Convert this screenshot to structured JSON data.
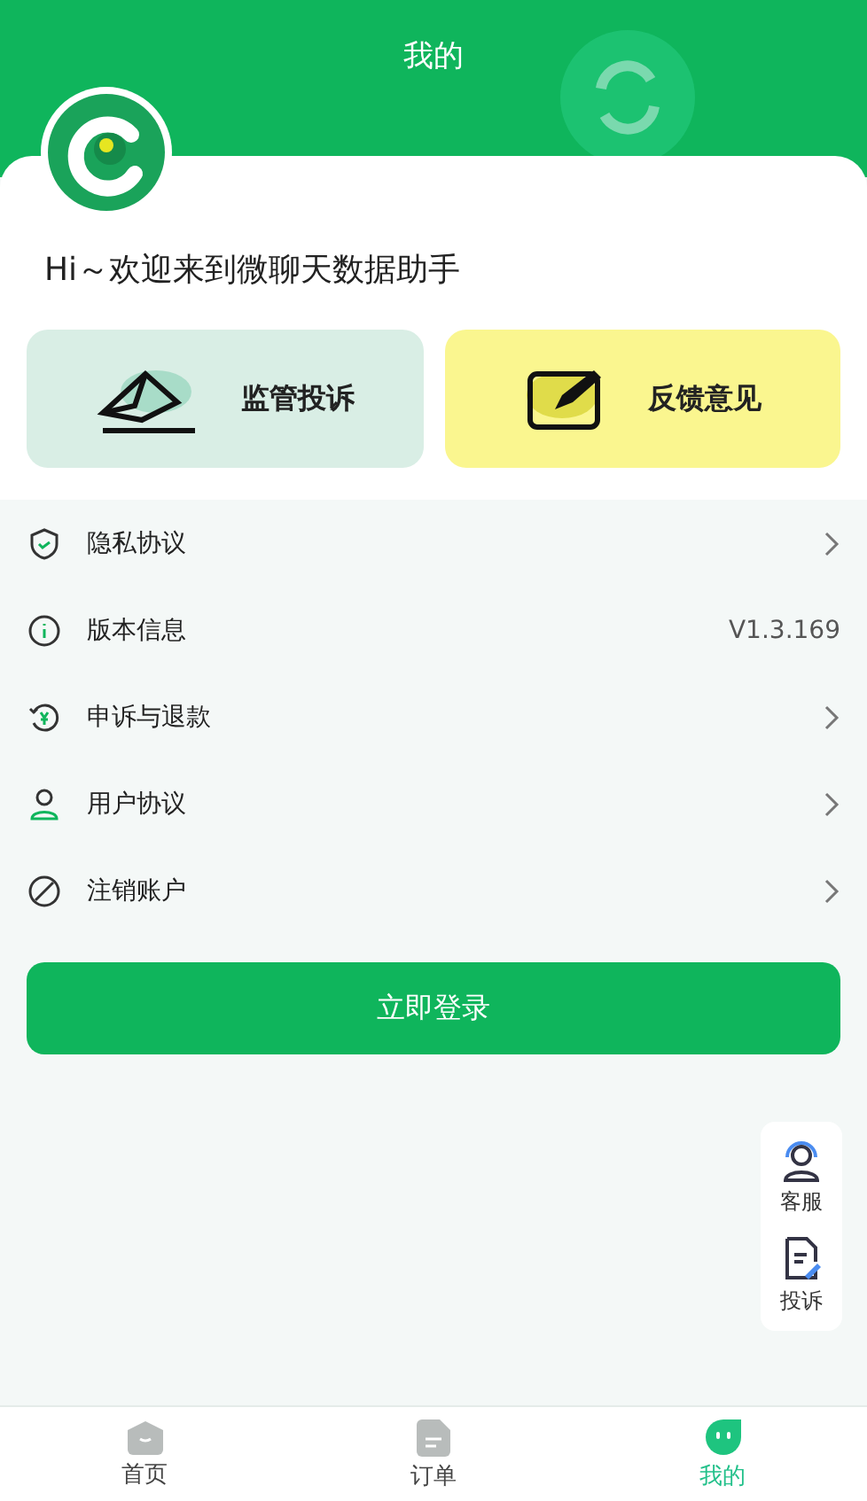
{
  "header": {
    "title": "我的"
  },
  "greeting": "Hi～欢迎来到微聊天数据助手",
  "action_cards": [
    {
      "kind": "complaint",
      "label": "监管投诉"
    },
    {
      "kind": "feedback",
      "label": "反馈意见"
    }
  ],
  "menu": [
    {
      "kind": "link",
      "label": "隐私协议"
    },
    {
      "kind": "info",
      "label": "版本信息",
      "value": "V1.3.169"
    },
    {
      "kind": "link",
      "label": "申诉与退款"
    },
    {
      "kind": "link",
      "label": "用户协议"
    },
    {
      "kind": "link",
      "label": "注销账户"
    }
  ],
  "login_button": "立即登录",
  "float_panel": [
    {
      "label": "客服"
    },
    {
      "label": "投诉"
    }
  ],
  "tab_bar": [
    {
      "label": "首页",
      "selected": false
    },
    {
      "label": "订单",
      "selected": false
    },
    {
      "label": "我的",
      "selected": true
    }
  ]
}
